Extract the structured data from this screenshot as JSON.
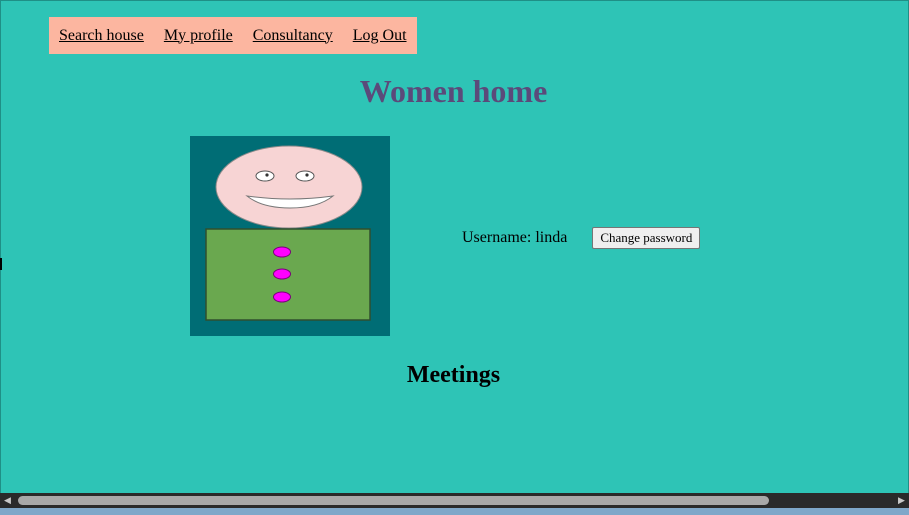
{
  "nav": {
    "items": [
      {
        "label": "Search house"
      },
      {
        "label": "My profile"
      },
      {
        "label": "Consultancy"
      },
      {
        "label": "Log Out"
      }
    ]
  },
  "page": {
    "title": "Women home"
  },
  "profile": {
    "username_label": "Username:",
    "username_value": "linda",
    "change_password_label": "Change password"
  },
  "meetings": {
    "title": "Meetings"
  },
  "colors": {
    "background": "#2ec4b6",
    "nav_background": "#fcb6a0",
    "title_color": "#5b4a7a",
    "avatar_background": "#006d75",
    "avatar_face": "#f7d4d4",
    "avatar_body": "#6aa84f",
    "avatar_buttons": "#ff00ff"
  },
  "icons": {
    "avatar": "cartoon-person-avatar",
    "scroll_left": "triangle-left",
    "scroll_right": "triangle-right"
  }
}
